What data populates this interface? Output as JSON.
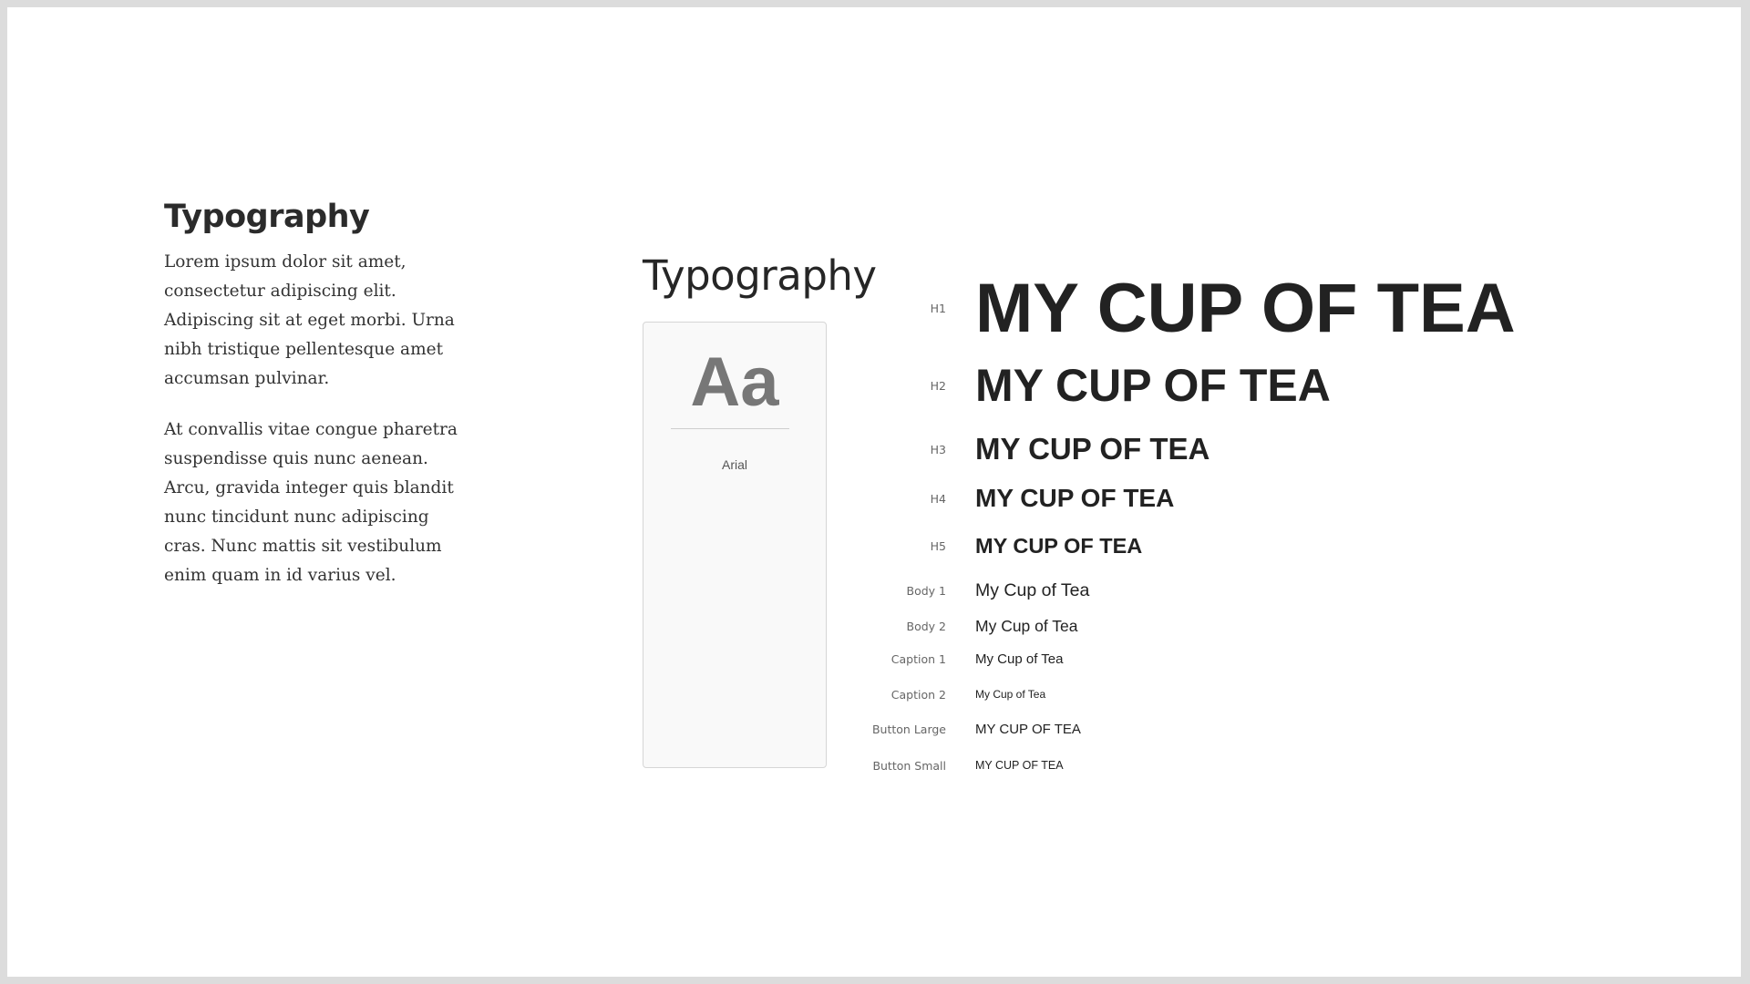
{
  "intro": {
    "title": "Typography",
    "paragraphs": [
      "Lorem ipsum dolor sit amet, consectetur adipiscing elit. Adipiscing sit at eget morbi. Urna nibh tristique pellentesque amet accumsan pulvinar.",
      "At convallis vitae congue pharetra suspendisse quis nunc aenean. Arcu, gravida integer quis blandit nunc tincidunt nunc adipiscing cras. Nunc mattis sit vestibulum enim quam in id varius vel."
    ]
  },
  "type_panel": {
    "title": "Typography",
    "font_card": {
      "sample": "Aa",
      "font_name": "Arial"
    },
    "scale": [
      {
        "label": "H1",
        "sample": "MY CUP OF TEA"
      },
      {
        "label": "H2",
        "sample": "MY CUP OF TEA"
      },
      {
        "label": "H3",
        "sample": "MY CUP OF TEA"
      },
      {
        "label": "H4",
        "sample": "MY CUP OF TEA"
      },
      {
        "label": "H5",
        "sample": "MY CUP OF TEA"
      },
      {
        "label": "Body 1",
        "sample": "My Cup of Tea"
      },
      {
        "label": "Body 2",
        "sample": "My Cup of Tea"
      },
      {
        "label": "Caption 1",
        "sample": "My Cup of Tea"
      },
      {
        "label": "Caption 2",
        "sample": "My Cup of Tea"
      },
      {
        "label": "Button Large",
        "sample": "MY CUP OF TEA"
      },
      {
        "label": "Button Small",
        "sample": "MY CUP OF TEA"
      }
    ]
  }
}
